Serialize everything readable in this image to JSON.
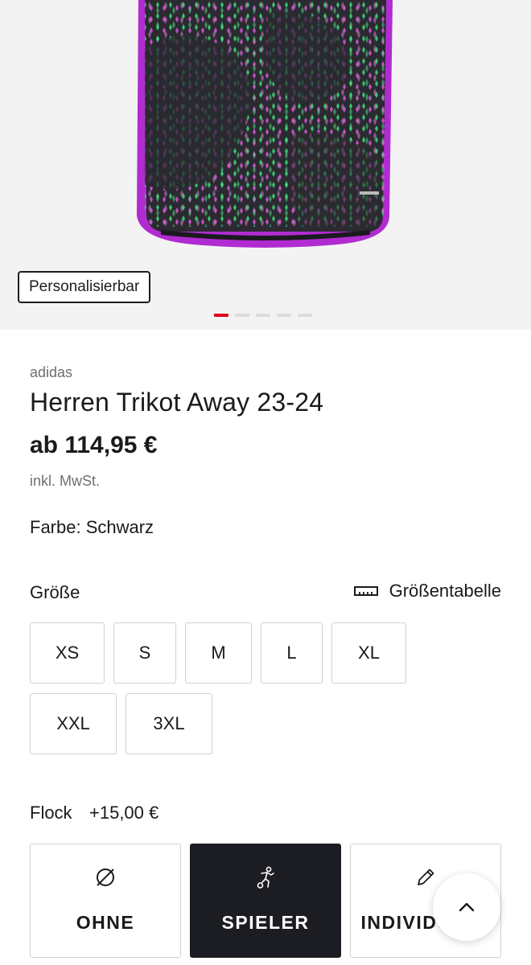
{
  "product": {
    "badge": "Personalisierbar",
    "image_count": 5,
    "active_image": 1,
    "brand": "adidas",
    "title": "Herren Trikot Away 23-24",
    "price": "ab 114,95 €",
    "tax_note": "inkl. MwSt.",
    "color_line": "Farbe: Schwarz"
  },
  "size": {
    "label": "Größe",
    "chart_link": "Größentabelle",
    "options": [
      "XS",
      "S",
      "M",
      "L",
      "XL",
      "XXL",
      "3XL"
    ]
  },
  "flock": {
    "label": "Flock",
    "price": "+15,00 €",
    "options": [
      {
        "label": "OHNE",
        "icon": "empty-set-icon",
        "selected": false
      },
      {
        "label": "SPIELER",
        "icon": "player-icon",
        "selected": true
      },
      {
        "label": "INDIVIDUELL",
        "icon": "pencil-icon",
        "selected": false
      }
    ]
  },
  "colors": {
    "accent": "#e2001a",
    "dark": "#1c1d22",
    "jersey_trim": "#b02cd0",
    "jersey_body": "#2a2a30",
    "pattern_green": "#3ddc7a",
    "pattern_pink": "#d65ad8"
  }
}
